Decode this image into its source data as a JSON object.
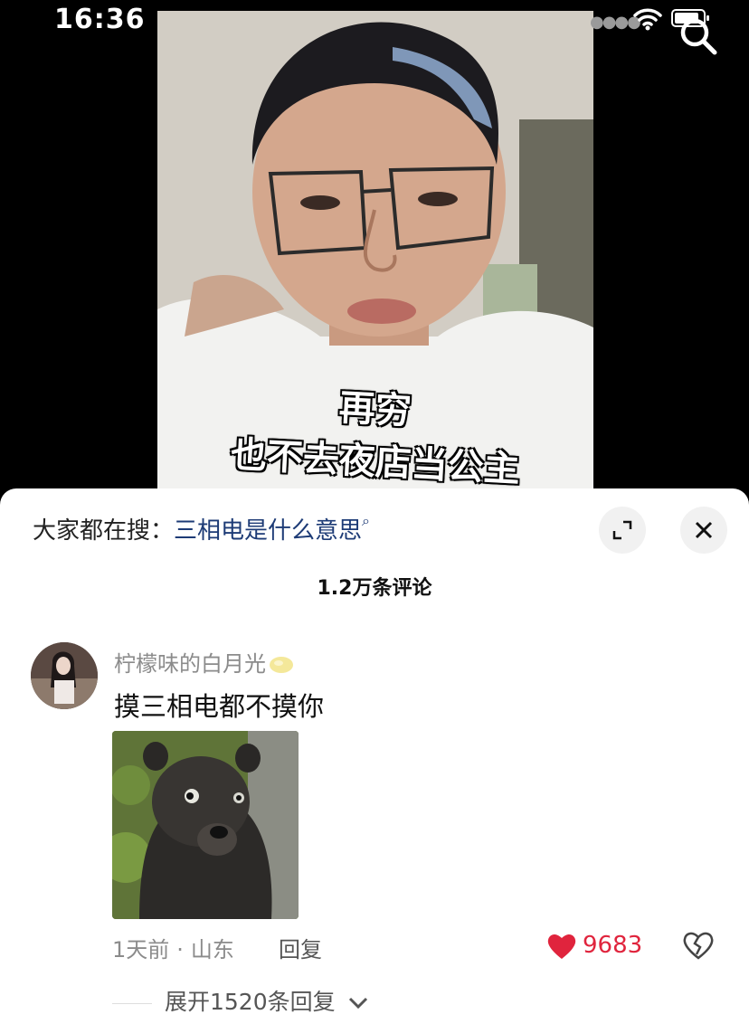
{
  "status": {
    "time": "16:36"
  },
  "video": {
    "caption_line1": "再穷",
    "caption_line2": "也不去夜店当公主"
  },
  "comments_panel": {
    "search_prefix": "大家都在搜：",
    "search_term": "三相电是什么意思",
    "count_label": "1.2万条评论",
    "comment": {
      "username": "柠檬味的白月光",
      "text": "摸三相电都不摸你",
      "time": "1天前",
      "location": "山东",
      "reply_label": "回复",
      "like_count": "9683",
      "expand_label": "展开1520条回复"
    }
  },
  "colors": {
    "like": "#e0243d",
    "search_term": "#1d3b76"
  }
}
